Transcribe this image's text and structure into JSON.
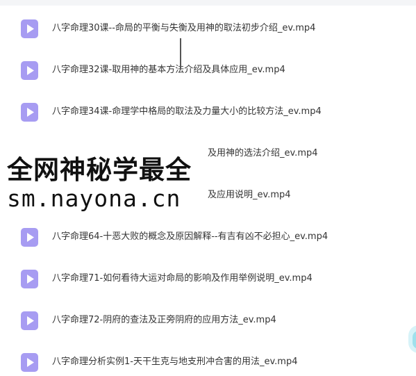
{
  "files": [
    {
      "name": "八字命理30课--命局的平衡与失衡及用神的取法初步介绍_ev.mp4",
      "icon": "video-file-icon"
    },
    {
      "name": "八字命理32课-取用神的基本方法介绍及具体应用_ev.mp4",
      "icon": "video-file-icon"
    },
    {
      "name": "八字命理34课-命理学中格局的取法及力量大小的比较方法_ev.mp4",
      "icon": "video-file-icon"
    },
    {
      "name": "及用神的选法介绍_ev.mp4",
      "icon": "video-file-icon"
    },
    {
      "name": "及应用说明_ev.mp4",
      "icon": "video-file-icon"
    },
    {
      "name": "八字命理64-十恶大败的概念及原因解释--有吉有凶不必担心_ev.mp4",
      "icon": "video-file-icon"
    },
    {
      "name": "八字命理71-如何看待大运对命局的影响及作用举例说明_ev.mp4",
      "icon": "video-file-icon"
    },
    {
      "name": "八字命理72-阴府的查法及正旁阴府的应用方法_ev.mp4",
      "icon": "video-file-icon"
    },
    {
      "name": "八字命理分析实例1-天干生克与地支刑冲合害的用法_ev.mp4",
      "icon": "video-file-icon"
    }
  ],
  "watermark": {
    "line1": "全网神秘学最全",
    "line2": "sm.nayona.cn"
  },
  "colors": {
    "icon_bg": "#a79cf2",
    "text": "#333333"
  }
}
